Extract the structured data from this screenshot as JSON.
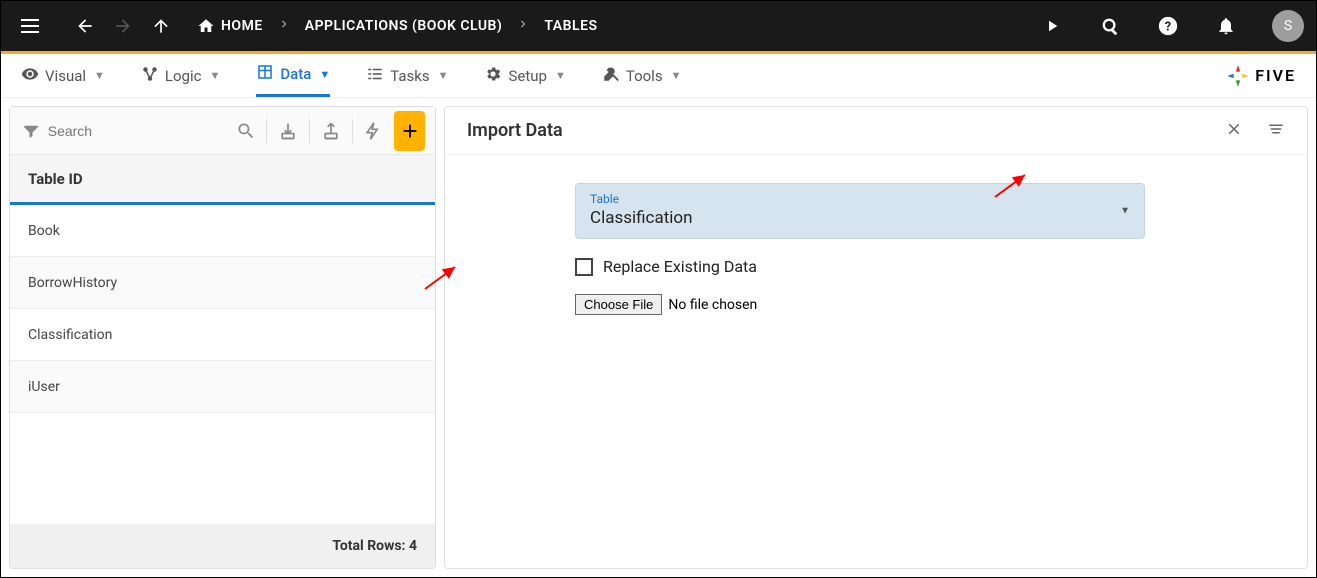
{
  "topbar": {
    "breadcrumbs": [
      "HOME",
      "APPLICATIONS (BOOK CLUB)",
      "TABLES"
    ],
    "avatar_letter": "S"
  },
  "nav": {
    "tabs": [
      {
        "label": "Visual"
      },
      {
        "label": "Logic"
      },
      {
        "label": "Data"
      },
      {
        "label": "Tasks"
      },
      {
        "label": "Setup"
      },
      {
        "label": "Tools"
      }
    ],
    "logo_text": "FIVE"
  },
  "left": {
    "search_placeholder": "Search",
    "column_header": "Table ID",
    "rows": [
      "Book",
      "BorrowHistory",
      "Classification",
      "iUser"
    ],
    "footer": "Total Rows: 4"
  },
  "right": {
    "title": "Import Data",
    "table_label": "Table",
    "table_value": "Classification",
    "replace_label": "Replace Existing Data",
    "choose_file_label": "Choose File",
    "no_file_text": "No file chosen"
  }
}
